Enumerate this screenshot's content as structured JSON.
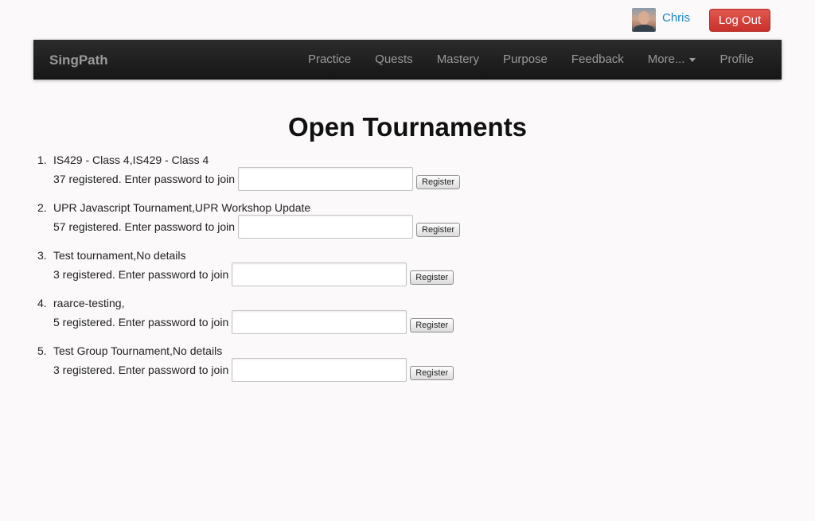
{
  "user": {
    "name": "Chris",
    "logout_label": "Log Out"
  },
  "navbar": {
    "brand": "SingPath",
    "items": [
      {
        "label": "Practice",
        "name": "nav-practice"
      },
      {
        "label": "Quests",
        "name": "nav-quests"
      },
      {
        "label": "Mastery",
        "name": "nav-mastery"
      },
      {
        "label": "Purpose",
        "name": "nav-purpose"
      },
      {
        "label": "Feedback",
        "name": "nav-feedback"
      },
      {
        "label": "More...",
        "name": "nav-more",
        "dropdown": true
      },
      {
        "label": "Profile",
        "name": "nav-profile"
      }
    ]
  },
  "page": {
    "title": "Open Tournaments"
  },
  "tournaments": [
    {
      "number": "1.",
      "name": "IS429 - Class 4,IS429 - Class 4",
      "join_text": "37 registered. Enter password to join",
      "button": "Register"
    },
    {
      "number": "2.",
      "name": "UPR Javascript Tournament,UPR Workshop Update",
      "join_text": "57 registered. Enter password to join",
      "button": "Register"
    },
    {
      "number": "3.",
      "name": "Test tournament,No details",
      "join_text": "3 registered. Enter password to join",
      "button": "Register"
    },
    {
      "number": "4.",
      "name": "raarce-testing,",
      "join_text": "5 registered. Enter password to join",
      "button": "Register"
    },
    {
      "number": "5.",
      "name": "Test Group Tournament,No details",
      "join_text": "3 registered. Enter password to join",
      "button": "Register"
    }
  ]
}
